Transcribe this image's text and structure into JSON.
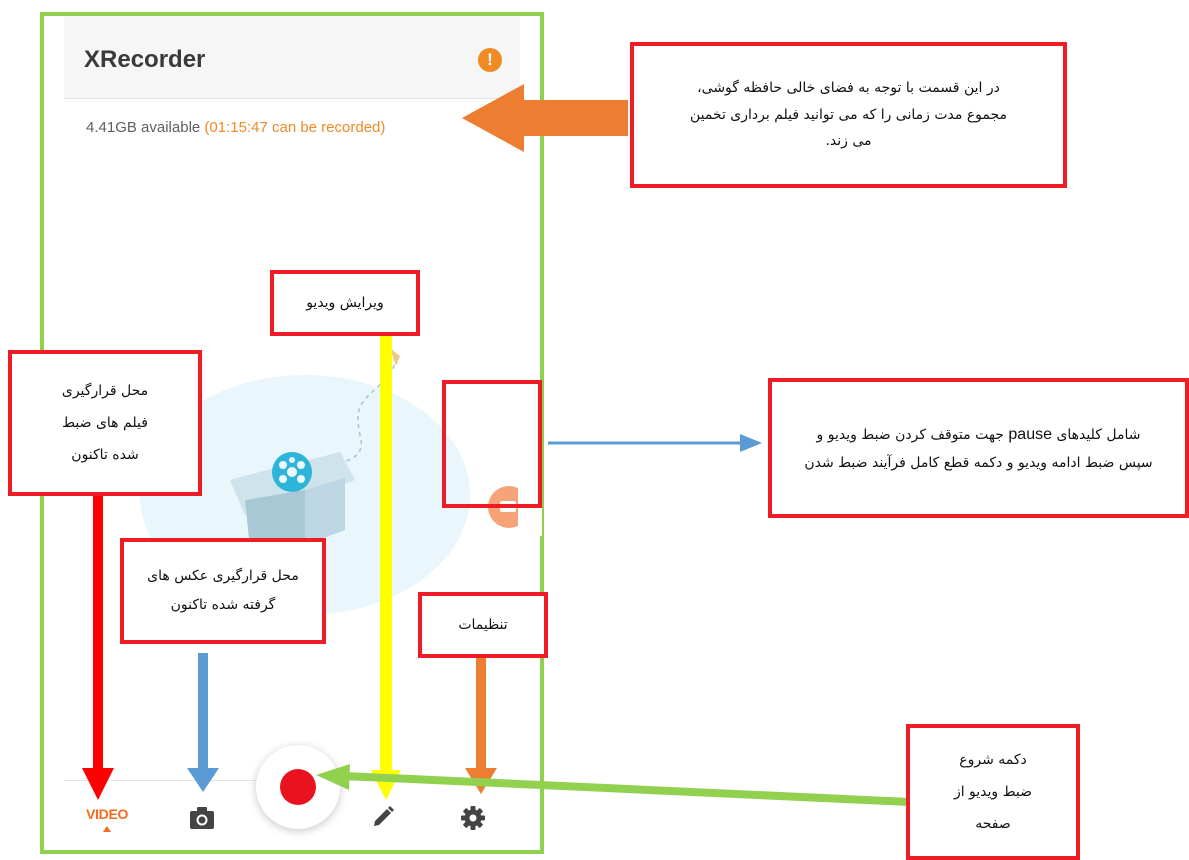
{
  "app": {
    "title": "XRecorder",
    "alert_icon": "!",
    "storage_prefix": "4.41GB available ",
    "storage_highlight": "(01:15:47 can be recorded)",
    "video_tab_label": "VIDEO"
  },
  "annotations": {
    "storage_note": "در این قسمت با توجه به فضای خالی حافظه گوشی، مجموع مدت زمانی را که می توانید فیلم برداری تخمین می زند.",
    "edit_note": "ویرایش ویدیو",
    "video_location_note": "محل قرارگیری فیلم های ضبط شده تاکنون",
    "pause_note_part1": "شامل کلیدهای",
    "pause_note_word": "pause",
    "pause_note_part2": "جهت متوقف کردن ضبط ویدیو و سپس ضبط ادامه ویدیو و دکمه قطع کامل فرآیند ضبط شدن",
    "photo_location_note": "محل قرارگیری عکس های گرفته شده تاکنون",
    "settings_note": "تنظیمات",
    "record_note": "دکمه شروع ضبط ویدیو از صفحه"
  },
  "colors": {
    "accent": "#f08a24",
    "record": "#e8131f",
    "frame": "#8fd14f",
    "annotation_border": "#ee1c24",
    "arrow_red": "#ff0000",
    "arrow_blue": "#5b9bd5",
    "arrow_yellow": "#ffff00",
    "arrow_orange": "#ed7d31",
    "arrow_green": "#92d050"
  },
  "icons": [
    "alert-icon",
    "film-box-illustration",
    "floating-record-icon",
    "camera-icon",
    "record-icon",
    "pencil-icon",
    "gear-icon"
  ]
}
